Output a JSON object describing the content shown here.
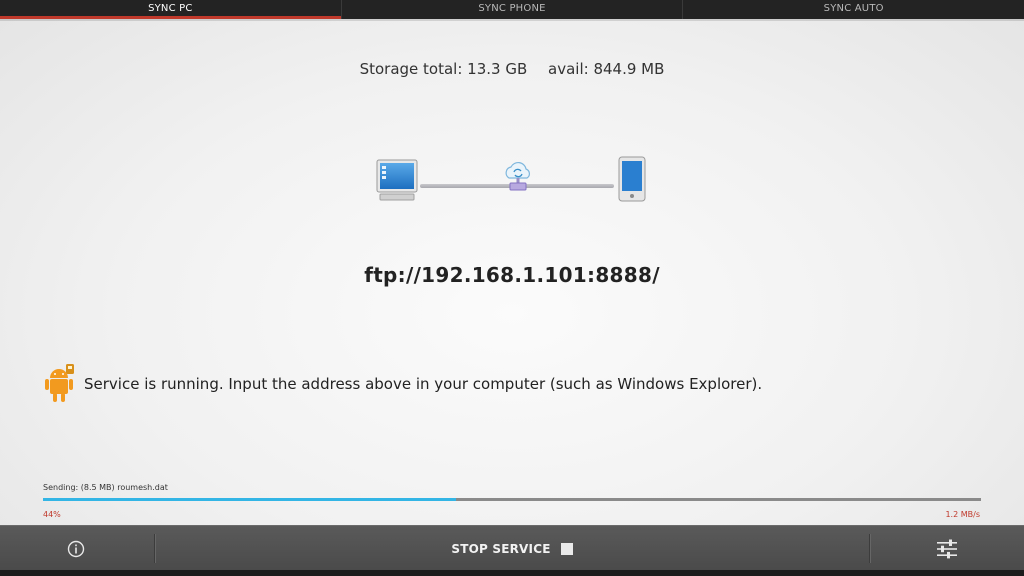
{
  "tabs": [
    {
      "label": "SYNC PC",
      "active": true
    },
    {
      "label": "SYNC PHONE",
      "active": false
    },
    {
      "label": "SYNC AUTO",
      "active": false
    }
  ],
  "storage": {
    "total": "Storage total: 13.3 GB",
    "avail": "avail: 844.9 MB"
  },
  "connection": {
    "icons": [
      "computer-icon",
      "cloud-sync-icon",
      "phone-icon"
    ],
    "address": "ftp://192.168.1.101:8888/"
  },
  "status": {
    "icon": "android-lock-icon",
    "message": "Service is running. Input the address above in your computer (such as Windows Explorer)."
  },
  "transfer": {
    "sending": "Sending: (8.5 MB) roumesh.dat",
    "percent_label": "44%",
    "progress": 0.44,
    "speed": "1.2 MB/s"
  },
  "bottom_bar": {
    "info_icon": "info-icon",
    "stop_label": "STOP SERVICE",
    "settings_icon": "settings-sliders-icon"
  },
  "colors": {
    "tab_active_indicator": "#c0392b",
    "progress_fill": "#33b5e5",
    "accent_text": "#c0392b"
  }
}
